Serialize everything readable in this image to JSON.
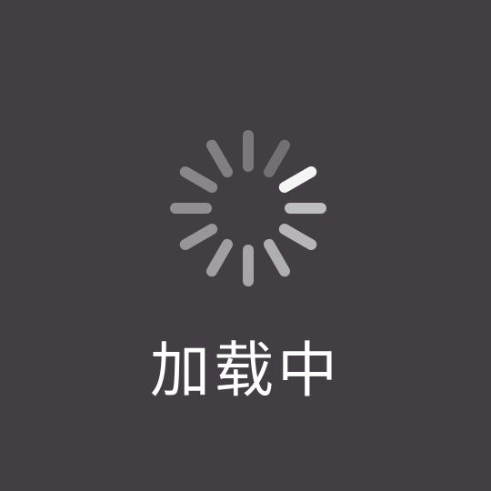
{
  "overlay": {
    "background_color": "#423e43",
    "spinner": {
      "icon": "loading-spinner-icon",
      "spoke_color": "#ffffff",
      "spoke_count": 12,
      "highlight_spoke": 2
    },
    "message": "加载中"
  }
}
